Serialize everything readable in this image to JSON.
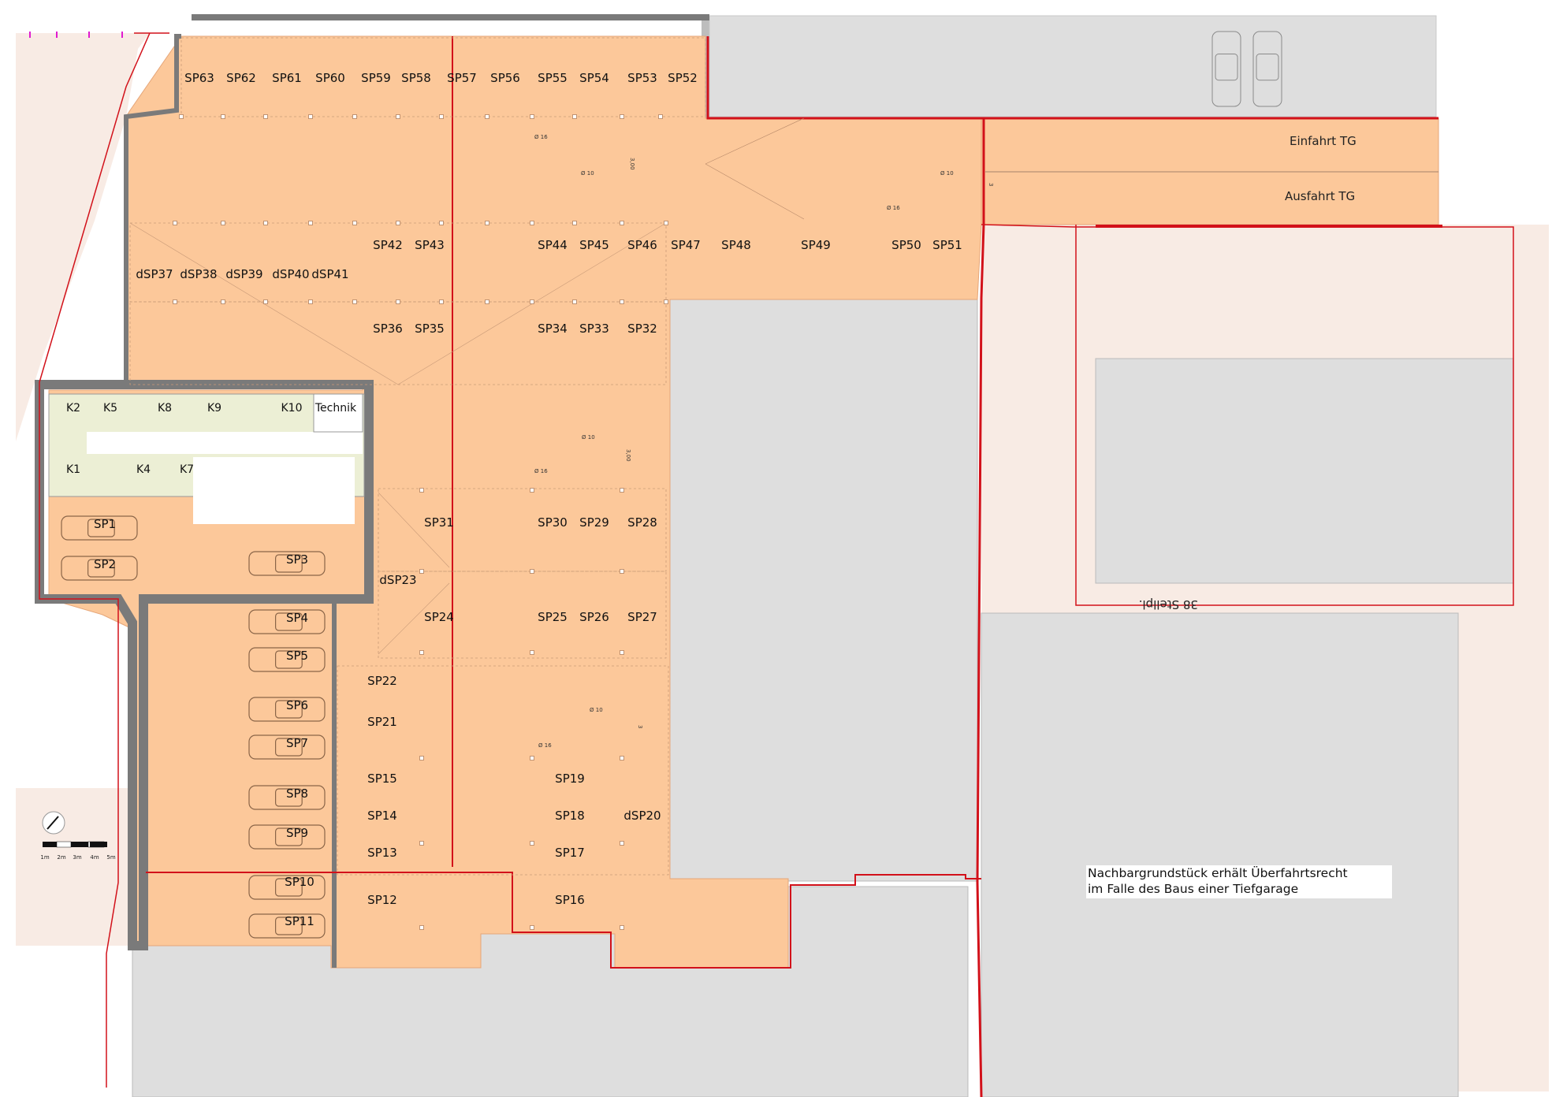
{
  "colors": {
    "garage_fill": "#fcc89a",
    "garage_edge": "#eaa87a",
    "neighbor_fill": "#dedede",
    "plot_fill": "#f8ebe4",
    "wall": "#7a7a7a",
    "boundary_red": "#d2111a",
    "cellar_fill": "#ecefd5"
  },
  "spaces": [
    {
      "id": "sp63",
      "label": "SP63"
    },
    {
      "id": "sp62",
      "label": "SP62"
    },
    {
      "id": "sp61",
      "label": "SP61"
    },
    {
      "id": "sp60",
      "label": "SP60"
    },
    {
      "id": "sp59",
      "label": "SP59"
    },
    {
      "id": "sp58",
      "label": "SP58"
    },
    {
      "id": "sp57",
      "label": "SP57"
    },
    {
      "id": "sp56",
      "label": "SP56"
    },
    {
      "id": "sp55",
      "label": "SP55"
    },
    {
      "id": "sp54",
      "label": "SP54"
    },
    {
      "id": "sp53",
      "label": "SP53"
    },
    {
      "id": "sp52",
      "label": "SP52"
    },
    {
      "id": "dsp37",
      "label": "dSP37"
    },
    {
      "id": "dsp38",
      "label": "dSP38"
    },
    {
      "id": "dsp39",
      "label": "dSP39"
    },
    {
      "id": "dsp40",
      "label": "dSP40"
    },
    {
      "id": "dsp41",
      "label": "dSP41"
    },
    {
      "id": "sp42",
      "label": "SP42"
    },
    {
      "id": "sp43",
      "label": "SP43"
    },
    {
      "id": "sp44",
      "label": "SP44"
    },
    {
      "id": "sp45",
      "label": "SP45"
    },
    {
      "id": "sp46",
      "label": "SP46"
    },
    {
      "id": "sp47",
      "label": "SP47"
    },
    {
      "id": "sp48",
      "label": "SP48"
    },
    {
      "id": "sp49",
      "label": "SP49"
    },
    {
      "id": "sp50",
      "label": "SP50"
    },
    {
      "id": "sp51",
      "label": "SP51"
    },
    {
      "id": "sp36",
      "label": "SP36"
    },
    {
      "id": "sp35",
      "label": "SP35"
    },
    {
      "id": "sp34",
      "label": "SP34"
    },
    {
      "id": "sp33",
      "label": "SP33"
    },
    {
      "id": "sp32",
      "label": "SP32"
    },
    {
      "id": "sp31",
      "label": "SP31"
    },
    {
      "id": "sp30",
      "label": "SP30"
    },
    {
      "id": "sp29",
      "label": "SP29"
    },
    {
      "id": "sp28",
      "label": "SP28"
    },
    {
      "id": "dsp23",
      "label": "dSP23"
    },
    {
      "id": "sp24",
      "label": "SP24"
    },
    {
      "id": "sp25",
      "label": "SP25"
    },
    {
      "id": "sp26",
      "label": "SP26"
    },
    {
      "id": "sp27",
      "label": "SP27"
    },
    {
      "id": "sp22",
      "label": "SP22"
    },
    {
      "id": "sp21",
      "label": "SP21"
    },
    {
      "id": "sp15",
      "label": "SP15"
    },
    {
      "id": "sp14",
      "label": "SP14"
    },
    {
      "id": "sp13",
      "label": "SP13"
    },
    {
      "id": "sp12",
      "label": "SP12"
    },
    {
      "id": "sp19",
      "label": "SP19"
    },
    {
      "id": "sp18",
      "label": "SP18"
    },
    {
      "id": "dsp20",
      "label": "dSP20"
    },
    {
      "id": "sp17",
      "label": "SP17"
    },
    {
      "id": "sp16",
      "label": "SP16"
    },
    {
      "id": "sp1",
      "label": "SP1"
    },
    {
      "id": "sp2",
      "label": "SP2"
    },
    {
      "id": "sp3",
      "label": "SP3"
    },
    {
      "id": "sp4",
      "label": "SP4"
    },
    {
      "id": "sp5",
      "label": "SP5"
    },
    {
      "id": "sp6",
      "label": "SP6"
    },
    {
      "id": "sp7",
      "label": "SP7"
    },
    {
      "id": "sp8",
      "label": "SP8"
    },
    {
      "id": "sp9",
      "label": "SP9"
    },
    {
      "id": "sp10",
      "label": "SP10"
    },
    {
      "id": "sp11",
      "label": "SP11"
    }
  ],
  "rooms": [
    {
      "id": "k2",
      "label": "K2"
    },
    {
      "id": "k5",
      "label": "K5"
    },
    {
      "id": "k8",
      "label": "K8"
    },
    {
      "id": "k9",
      "label": "K9"
    },
    {
      "id": "k10",
      "label": "K10"
    },
    {
      "id": "technik",
      "label": "Technik"
    },
    {
      "id": "k1",
      "label": "K1"
    },
    {
      "id": "k4",
      "label": "K4"
    },
    {
      "id": "k7",
      "label": "K7"
    }
  ],
  "ramp": {
    "entry": "Einfahrt TG",
    "exit": "Ausfahrt TG"
  },
  "neighbor_note_text": "38 Stellpl.",
  "note": {
    "line1": "Nachbargrundstück erhält Überfahrtsrecht",
    "line2": "im Falle des Baus einer Tiefgarage"
  },
  "dimensions": [
    "Ø 16",
    "Ø 10",
    "3,00",
    "3"
  ],
  "scale_bar": {
    "ticks": [
      "1m",
      "2m",
      "3m",
      "4m",
      "5m"
    ]
  }
}
